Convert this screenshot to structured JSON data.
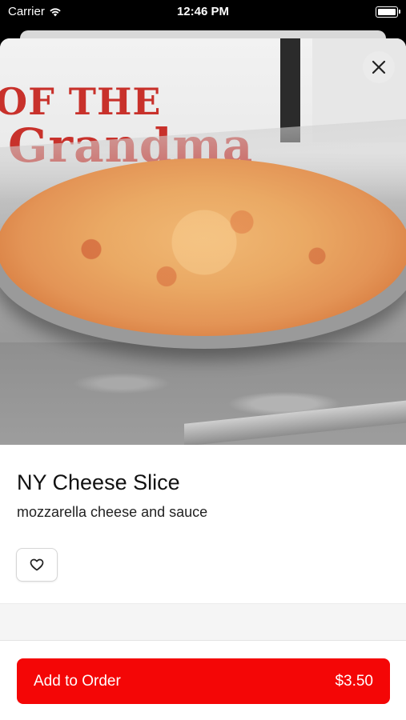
{
  "status_bar": {
    "carrier": "Carrier",
    "time": "12:46 PM"
  },
  "hero": {
    "image": "pizza-photo",
    "sign_line1": "OF THE",
    "sign_line2": "Grandma",
    "close_icon": "×"
  },
  "item": {
    "name": "NY Cheese Slice",
    "description": "mozzarella cheese and sauce"
  },
  "footer": {
    "add_label": "Add to Order",
    "price": "$3.50",
    "accent_color": "#f40606"
  },
  "icons": {
    "favorite": "heart-icon",
    "close": "close-icon",
    "wifi": "wifi-icon",
    "battery": "battery-icon"
  }
}
